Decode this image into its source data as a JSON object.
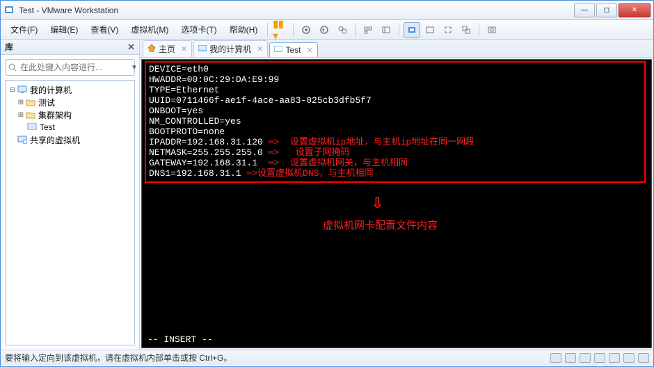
{
  "window": {
    "title": "Test - VMware Workstation"
  },
  "menu": {
    "file": "文件(F)",
    "edit": "编辑(E)",
    "view": "查看(V)",
    "vm": "虚拟机(M)",
    "tabs": "选项卡(T)",
    "help": "帮助(H)"
  },
  "sidebar": {
    "title": "库",
    "search_placeholder": "在此处键入内容进行...",
    "tree": {
      "root": "我的计算机",
      "items": [
        "测试",
        "集群架构",
        "Test"
      ],
      "shared": "共享的虚拟机"
    }
  },
  "tabs": {
    "home": "主页",
    "my": "我的计算机",
    "test": "Test"
  },
  "terminal": {
    "lines": [
      "DEVICE=eth0",
      "HWADDR=00:0C:29:DA:E9:99",
      "TYPE=Ethernet",
      "UUID=0711466f-ae1f-4ace-aa83-025cb3dfb5f7",
      "ONBOOT=yes",
      "NM_CONTROLLED=yes",
      "BOOTPROTO=none",
      "IPADDR=192.168.31.120",
      "NETMASK=255.255.255.0",
      "GATEWAY=192.168.31.1",
      "DNS1=192.168.31.1"
    ],
    "annotations": {
      "ip": "设置虚拟机ip地址，与主机ip地址在同一网段",
      "mask": "设置子网掩码",
      "gw": "设置虚拟机网关，与主机相同",
      "dns": "设置虚拟机DNS，与主机相同"
    },
    "caption": "虚拟机网卡配置文件内容",
    "mode": "-- INSERT --"
  },
  "status": {
    "text": "要将输入定向到该虚拟机，请在虚拟机内部单击或按 Ctrl+G。"
  }
}
